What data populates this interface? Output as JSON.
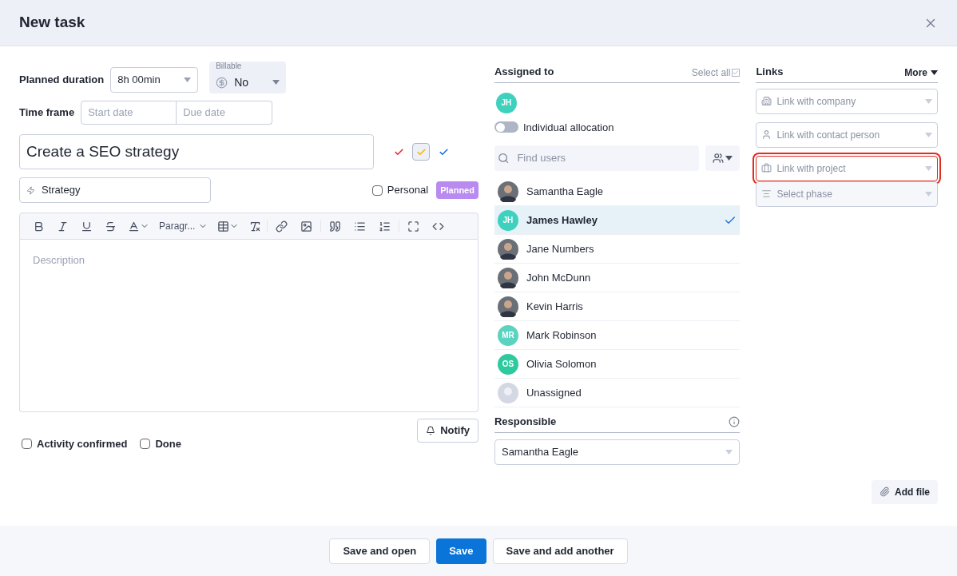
{
  "dialog": {
    "title": "New task"
  },
  "planned_duration": {
    "label": "Planned duration",
    "value": "8h 00min"
  },
  "billable": {
    "label": "Billable",
    "value": "No"
  },
  "time_frame": {
    "label": "Time frame",
    "start_placeholder": "Start date",
    "due_placeholder": "Due date"
  },
  "task_title": {
    "value": "Create a SEO strategy"
  },
  "priorities": [
    {
      "color": "#e5273d",
      "selected": false
    },
    {
      "color": "#f5b800",
      "selected": true
    },
    {
      "color": "#1a73d9",
      "selected": false
    }
  ],
  "category": {
    "value": "Strategy"
  },
  "personal": {
    "label": "Personal",
    "checked": false
  },
  "status_badge": "Planned",
  "editor": {
    "block_format": "Paragr...",
    "placeholder": "Description"
  },
  "notify_button": "Notify",
  "checkboxes": [
    {
      "label": "Activity confirmed",
      "checked": false
    },
    {
      "label": "Done",
      "checked": false
    }
  ],
  "assigned": {
    "title": "Select all",
    "heading": "Assigned to",
    "select_all_checked": true,
    "chips": [
      {
        "initials": "JH",
        "color": "#3ed1bd"
      }
    ],
    "individual_allocation": {
      "label": "Individual allocation",
      "on": false
    },
    "search_placeholder": "Find users"
  },
  "users": [
    {
      "name": "Samantha Eagle",
      "kind": "photo",
      "selected": false
    },
    {
      "name": "James Hawley",
      "kind": "initials",
      "initials": "JH",
      "color": "#3ed1bd",
      "selected": true
    },
    {
      "name": "Jane Numbers",
      "kind": "photo",
      "selected": false
    },
    {
      "name": "John McDunn",
      "kind": "photo",
      "selected": false
    },
    {
      "name": "Kevin Harris",
      "kind": "photo",
      "selected": false
    },
    {
      "name": "Mark Robinson",
      "kind": "initials",
      "initials": "MR",
      "color": "#5ad3c0",
      "selected": false
    },
    {
      "name": "Olivia Solomon",
      "kind": "initials",
      "initials": "OS",
      "color": "#2ec99e",
      "selected": false
    },
    {
      "name": "Unassigned",
      "kind": "blank",
      "selected": false
    }
  ],
  "responsible": {
    "heading": "Responsible",
    "value": "Samantha Eagle"
  },
  "links": {
    "heading": "Links",
    "more": "More",
    "items": [
      {
        "kind": "company",
        "placeholder": "Link with company",
        "highlighted": false
      },
      {
        "kind": "contact",
        "placeholder": "Link with contact person",
        "highlighted": false
      },
      {
        "kind": "project",
        "placeholder": "Link with project",
        "highlighted": true
      },
      {
        "kind": "phase",
        "placeholder": "Select phase",
        "highlighted": false
      }
    ]
  },
  "add_file": "Add file",
  "footer_buttons": [
    {
      "label": "Save and open",
      "kind": "secondary"
    },
    {
      "label": "Save",
      "kind": "primary"
    },
    {
      "label": "Save and add another",
      "kind": "secondary"
    }
  ]
}
